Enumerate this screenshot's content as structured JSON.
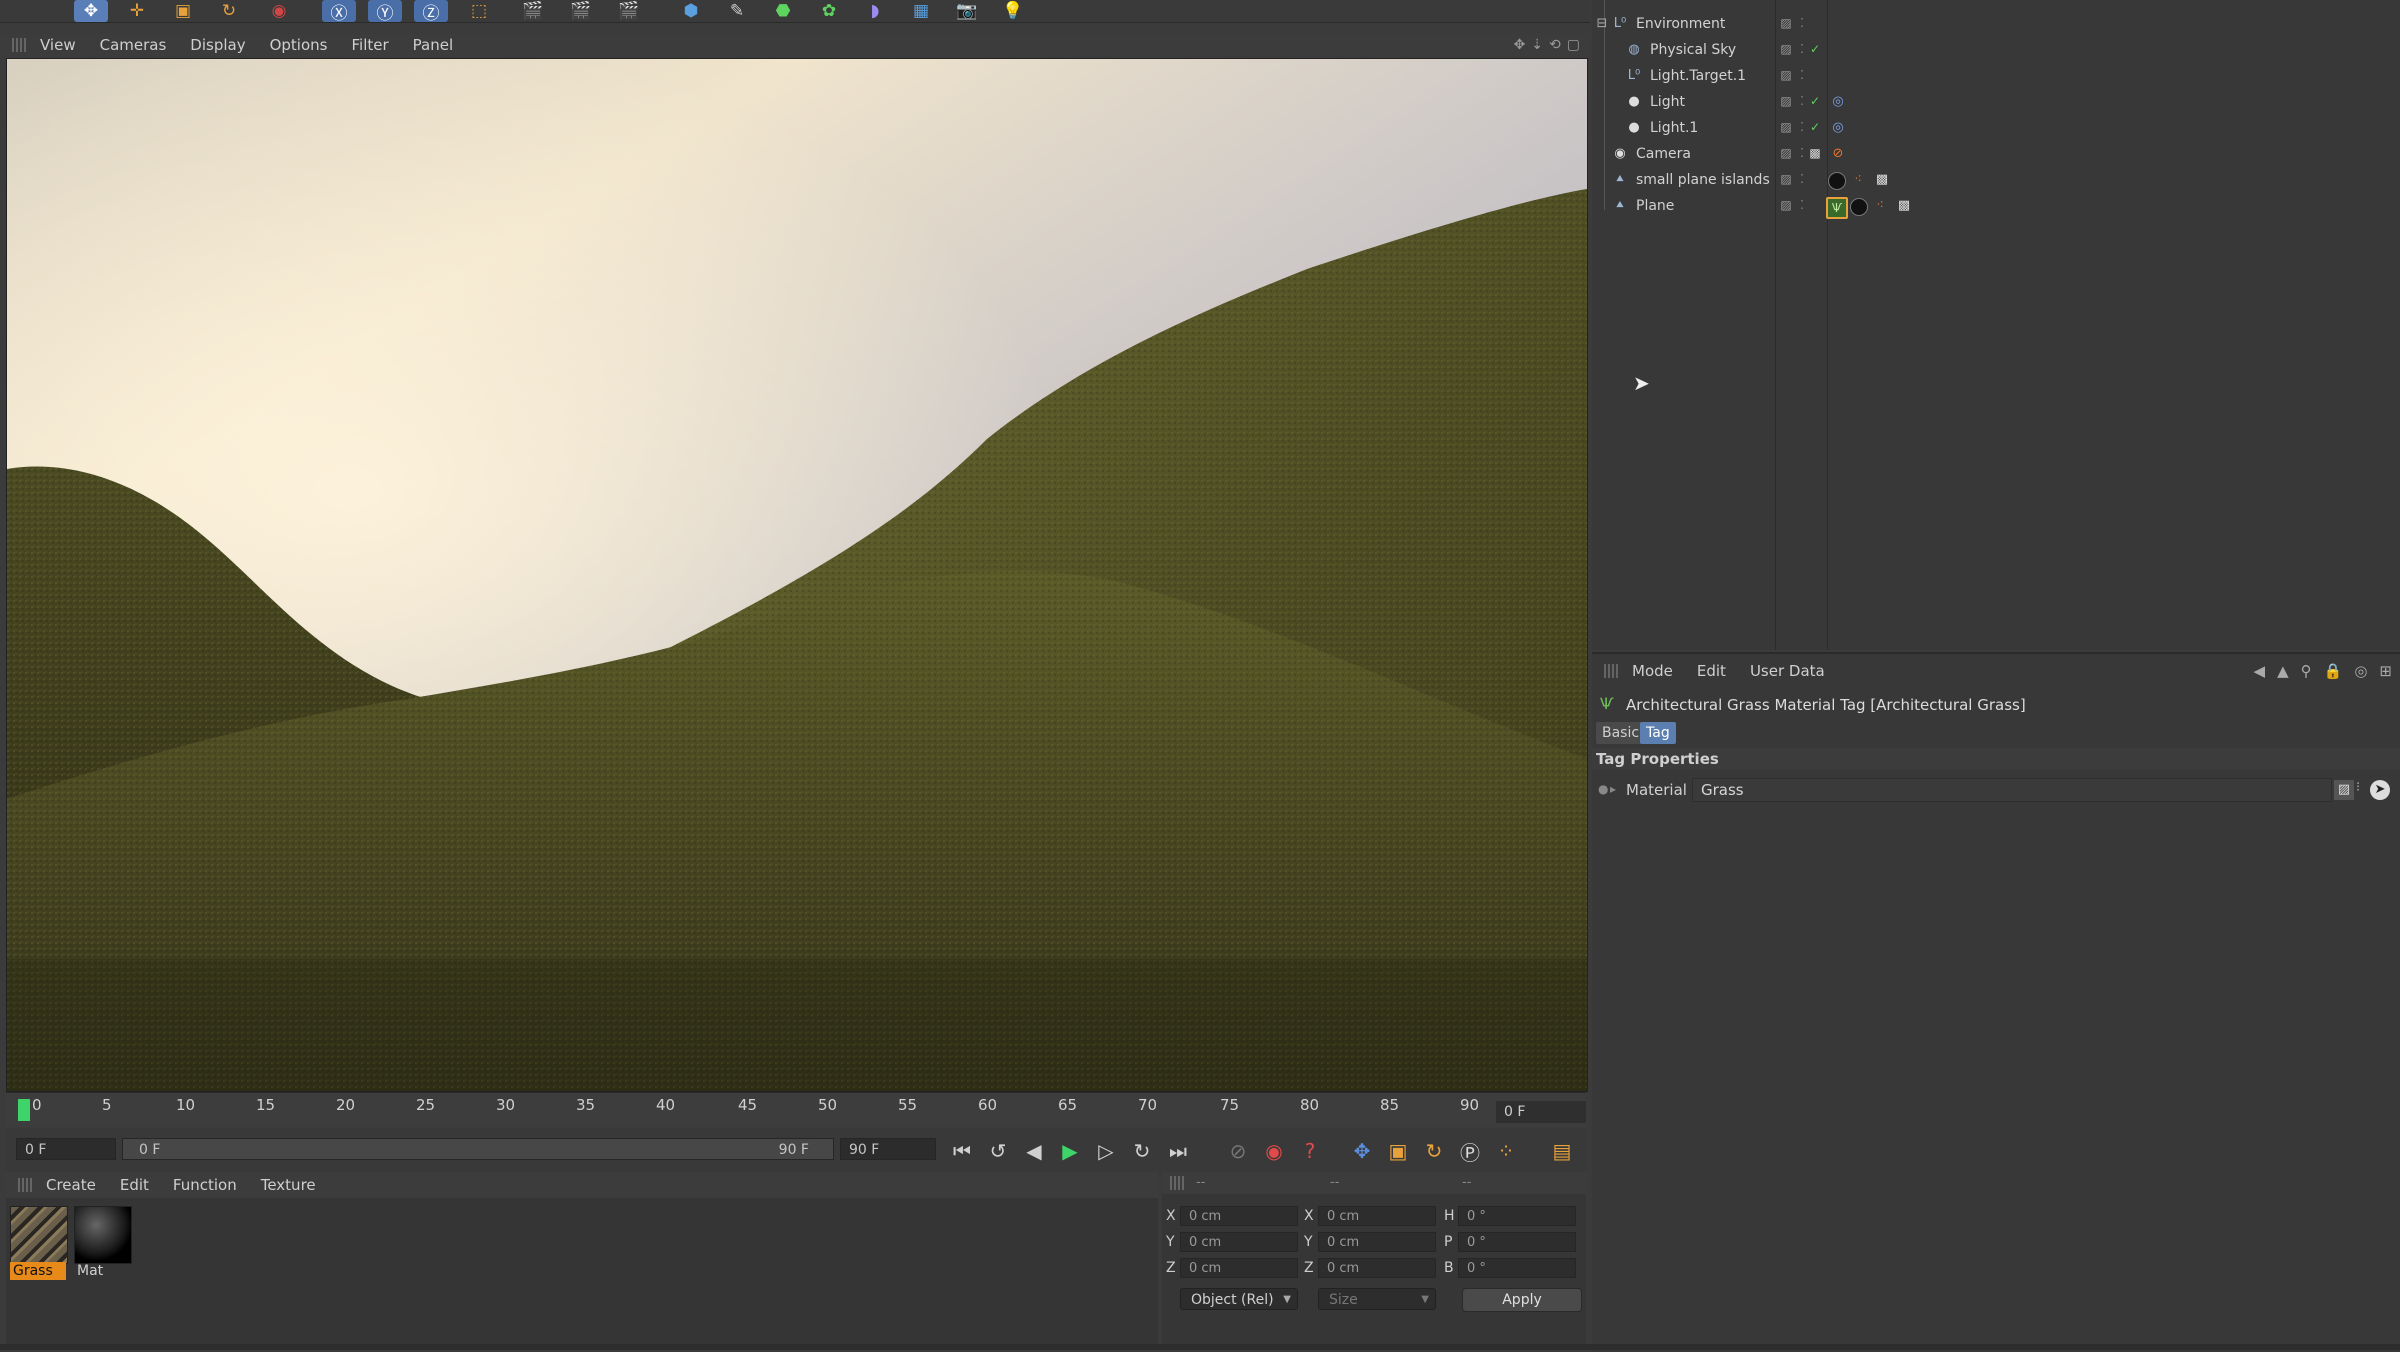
{
  "toolbar": {
    "icons": [
      "move-tool-icon",
      "scale-tool-icon",
      "rotate-tool-icon",
      "axis-x-icon",
      "axis-y-icon",
      "axis-z-icon",
      "coord-system-icon",
      "render-view-icon",
      "render-picture-viewer-icon",
      "render-settings-icon",
      "cube-icon",
      "spline-pen-icon",
      "subdivision-icon",
      "array-icon",
      "deformer-icon",
      "floor-icon",
      "camera-icon",
      "light-icon"
    ]
  },
  "viewport_menu": {
    "items": [
      "View",
      "Cameras",
      "Display",
      "Options",
      "Filter",
      "Panel"
    ]
  },
  "timeline": {
    "ticks": [
      "0",
      "5",
      "10",
      "15",
      "20",
      "25",
      "30",
      "35",
      "40",
      "45",
      "50",
      "55",
      "60",
      "65",
      "70",
      "75",
      "80",
      "85",
      "90"
    ],
    "current_frame_field": "0 F"
  },
  "transport": {
    "start_field": "0 F",
    "range_start": "0 F",
    "range_end": "90 F",
    "end_field": "90 F"
  },
  "material_manager": {
    "menu": [
      "Create",
      "Edit",
      "Function",
      "Texture"
    ],
    "materials": [
      {
        "name": "Grass",
        "selected": true
      },
      {
        "name": "Mat",
        "selected": false
      }
    ]
  },
  "coordinates": {
    "headers": [
      "--",
      "--",
      "--"
    ],
    "rows": [
      {
        "label1": "X",
        "val1": "0 cm",
        "label2": "X",
        "val2": "0 cm",
        "label3": "H",
        "val3": "0 °"
      },
      {
        "label1": "Y",
        "val1": "0 cm",
        "label2": "Y",
        "val2": "0 cm",
        "label3": "P",
        "val3": "0 °"
      },
      {
        "label1": "Z",
        "val1": "0 cm",
        "label2": "Z",
        "val2": "0 cm",
        "label3": "B",
        "val3": "0 °"
      }
    ],
    "mode_dropdown": "Object (Rel)",
    "size_dropdown": "Size",
    "apply_label": "Apply"
  },
  "object_manager": {
    "objects": [
      {
        "name": "Environment",
        "icon": "environment-icon",
        "indent": 0
      },
      {
        "name": "Physical Sky",
        "icon": "sky-icon",
        "indent": 1
      },
      {
        "name": "Light.Target.1",
        "icon": "target-icon",
        "indent": 1
      },
      {
        "name": "Light",
        "icon": "light-icon",
        "indent": 1
      },
      {
        "name": "Light.1",
        "icon": "light-icon",
        "indent": 1
      },
      {
        "name": "Camera",
        "icon": "camera-icon",
        "indent": 0
      },
      {
        "name": "small plane islands",
        "icon": "plane-icon",
        "indent": 0
      },
      {
        "name": "Plane",
        "icon": "plane-icon",
        "indent": 0
      }
    ]
  },
  "attributes": {
    "menu": [
      "Mode",
      "Edit",
      "User Data"
    ],
    "title": "Architectural Grass Material Tag [Architectural Grass]",
    "tabs": [
      "Basic",
      "Tag"
    ],
    "active_tab": "Tag",
    "section": "Tag Properties",
    "material_label": "Material",
    "material_value": "Grass"
  },
  "colors": {
    "accent_orange": "#e88a1a",
    "selection_blue": "#5c7fb2",
    "check_green": "#5fd35f"
  }
}
